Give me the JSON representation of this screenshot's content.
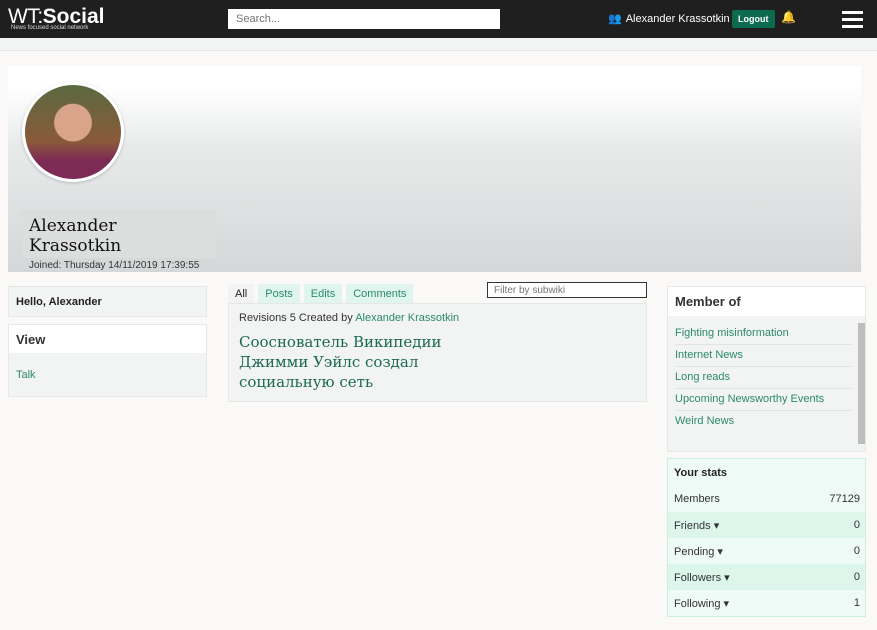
{
  "header": {
    "logo_wt": "WT:",
    "logo_social": "Social",
    "tagline": "News focused social network",
    "search_placeholder": "Search...",
    "user_name": "Alexander Krassotkin",
    "logout": "Logout",
    "user_icon": "user-icon",
    "bell_icon": "bell-icon",
    "menu_icon": "hamburger-icon"
  },
  "profile": {
    "name": "Alexander Krassotkin",
    "joined": "Joined: Thursday 14/11/2019 17:39:55"
  },
  "left": {
    "hello": "Hello, Alexander",
    "view_title": "View",
    "talk": "Talk"
  },
  "feed": {
    "tabs": [
      "All",
      "Posts",
      "Edits",
      "Comments"
    ],
    "filter_placeholder": "Filter by subwiki",
    "revisions": "Revisions 5 Created by",
    "author": "Alexander Krassotkin",
    "title": "Сооснователь Википедии Джимми Уэйлс создал социальную сеть"
  },
  "member": {
    "title": "Member of",
    "items": [
      "Fighting misinformation",
      "Internet News",
      "Long reads",
      "Upcoming Newsworthy Events",
      "Weird News"
    ]
  },
  "stats": {
    "title": "Your stats",
    "rows": [
      {
        "label": "Members",
        "value": "77129"
      },
      {
        "label": "Friends ▾",
        "value": "0"
      },
      {
        "label": "Pending ▾",
        "value": "0"
      },
      {
        "label": "Followers ▾",
        "value": "0"
      },
      {
        "label": "Following ▾",
        "value": "1"
      }
    ]
  },
  "colors": {
    "accent": "#0b6b4f",
    "link": "#2b8a6e",
    "topbar": "#1f1f1f"
  }
}
